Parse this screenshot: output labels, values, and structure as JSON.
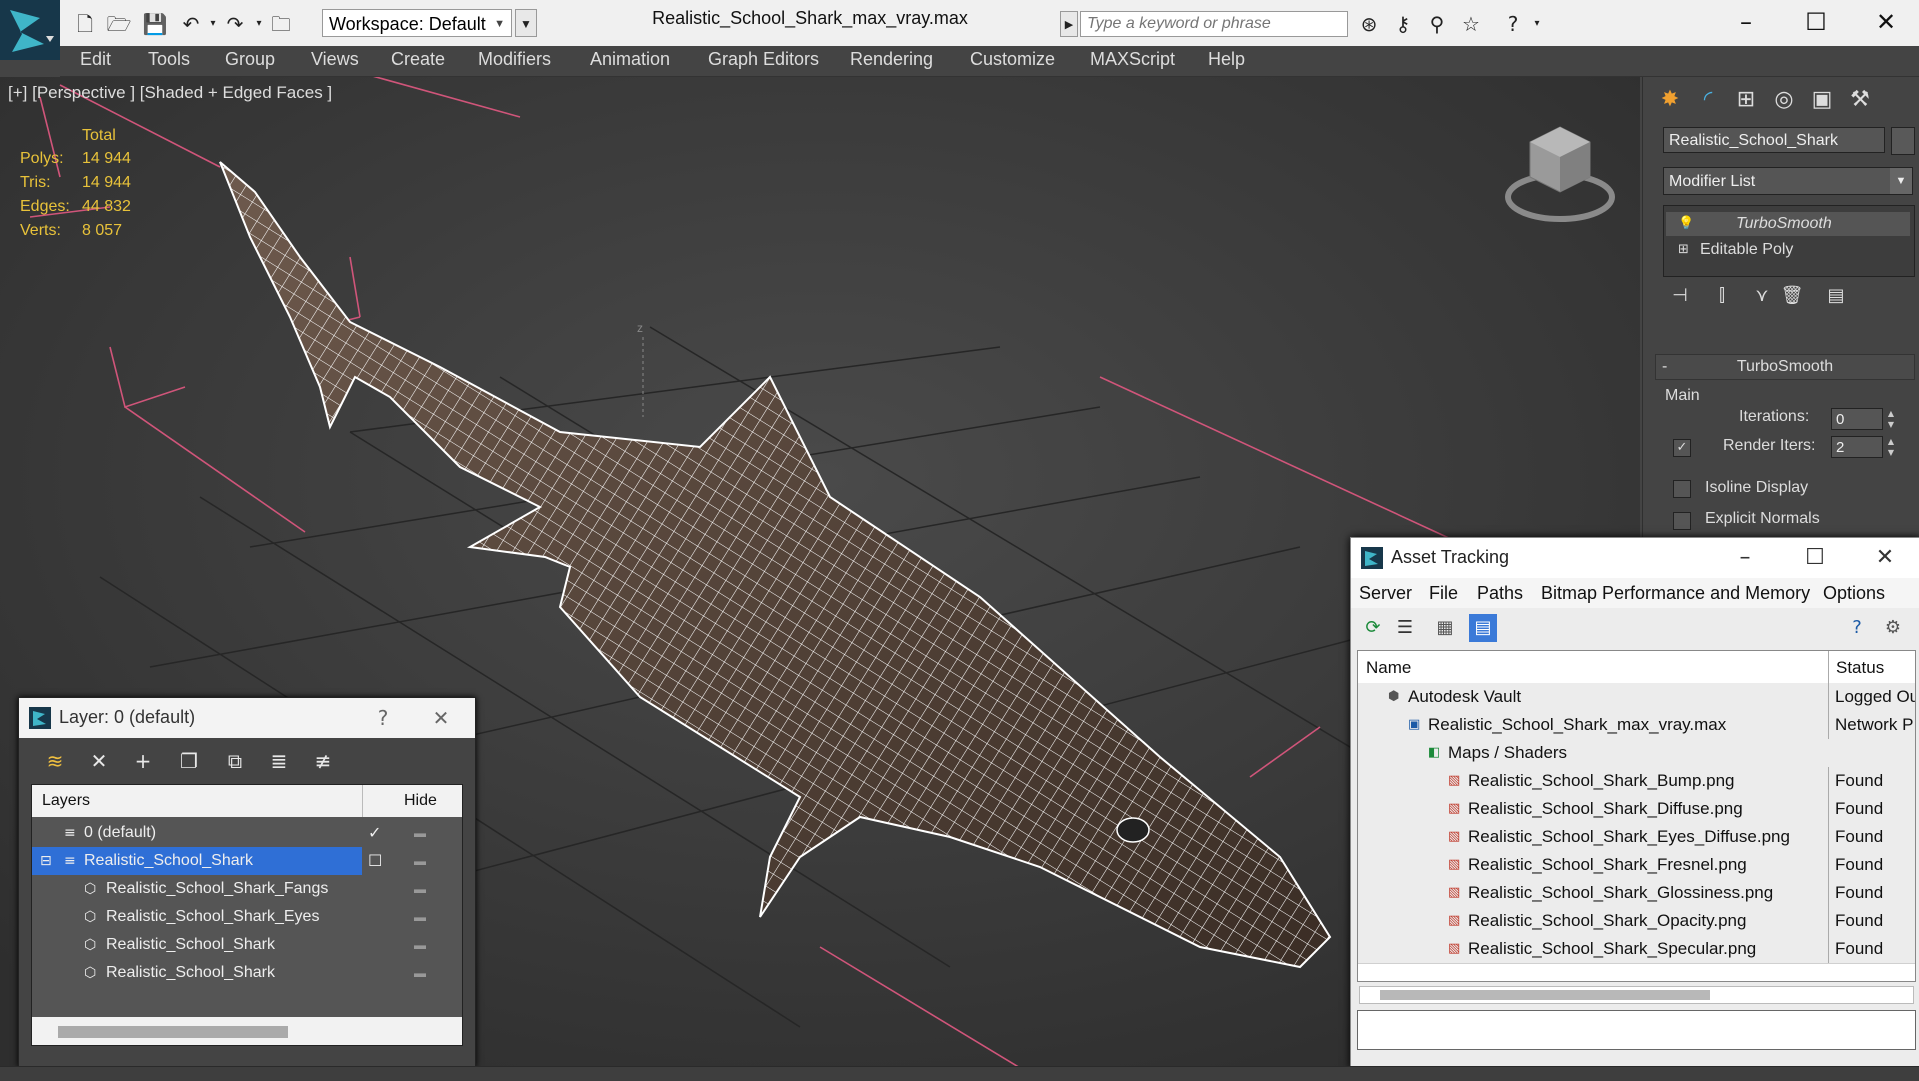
{
  "titlebar": {
    "workspace_label": "Workspace: Default",
    "document_title": "Realistic_School_Shark_max_vray.max",
    "search_placeholder": "Type a keyword or phrase"
  },
  "menubar": {
    "items": [
      "Edit",
      "Tools",
      "Group",
      "Views",
      "Create",
      "Modifiers",
      "Animation",
      "Graph Editors",
      "Rendering",
      "Customize",
      "MAXScript",
      "Help"
    ]
  },
  "viewport": {
    "label": "[+] [Perspective ] [Shaded + Edged Faces ]",
    "stats": {
      "total_label": "Total",
      "rows": [
        {
          "label": "Polys:",
          "value": "14 944"
        },
        {
          "label": "Tris:",
          "value": "14 944"
        },
        {
          "label": "Edges:",
          "value": "44 832"
        },
        {
          "label": "Verts:",
          "value": "8 057"
        }
      ]
    }
  },
  "command_panel": {
    "object_name": "Realistic_School_Shark",
    "modifier_list_label": "Modifier List",
    "stack": [
      "TurboSmooth",
      "Editable Poly"
    ],
    "rollout_title": "TurboSmooth",
    "group_label": "Main",
    "iterations_label": "Iterations:",
    "iterations_value": "0",
    "render_iters_label": "Render Iters:",
    "render_iters_value": "2",
    "isoline_label": "Isoline Display",
    "explicit_normals_label": "Explicit Normals"
  },
  "layer_dialog": {
    "title": "Layer: 0 (default)",
    "help": "?",
    "col_layers": "Layers",
    "col_hide": "Hide",
    "rows": [
      {
        "label": "0 (default)",
        "level": 1
      },
      {
        "label": "Realistic_School_Shark",
        "level": 1
      },
      {
        "label": "Realistic_School_Shark_Fangs",
        "level": 2
      },
      {
        "label": "Realistic_School_Shark_Eyes",
        "level": 2
      },
      {
        "label": "Realistic_School_Shark",
        "level": 2
      },
      {
        "label": "Realistic_School_Shark",
        "level": 2
      }
    ]
  },
  "asset_dialog": {
    "title": "Asset Tracking",
    "menu": [
      "Server",
      "File",
      "Paths",
      "Bitmap Performance and Memory",
      "Options"
    ],
    "col_name": "Name",
    "col_status": "Status",
    "rows": [
      {
        "name": "Autodesk Vault",
        "status": "Logged Ou",
        "level": 1,
        "icon": "vault"
      },
      {
        "name": "Realistic_School_Shark_max_vray.max",
        "status": "Network P",
        "level": 2,
        "icon": "max"
      },
      {
        "name": "Maps / Shaders",
        "status": "",
        "level": 3,
        "icon": "maps"
      },
      {
        "name": "Realistic_School_Shark_Bump.png",
        "status": "Found",
        "level": 4,
        "icon": "png"
      },
      {
        "name": "Realistic_School_Shark_Diffuse.png",
        "status": "Found",
        "level": 4,
        "icon": "png"
      },
      {
        "name": "Realistic_School_Shark_Eyes_Diffuse.png",
        "status": "Found",
        "level": 4,
        "icon": "png"
      },
      {
        "name": "Realistic_School_Shark_Fresnel.png",
        "status": "Found",
        "level": 4,
        "icon": "png"
      },
      {
        "name": "Realistic_School_Shark_Glossiness.png",
        "status": "Found",
        "level": 4,
        "icon": "png"
      },
      {
        "name": "Realistic_School_Shark_Opacity.png",
        "status": "Found",
        "level": 4,
        "icon": "png"
      },
      {
        "name": "Realistic_School_Shark_Specular.png",
        "status": "Found",
        "level": 4,
        "icon": "png"
      }
    ]
  },
  "colors": {
    "stats_yellow": "#e8c23a",
    "selection_blue": "#2f6fd6",
    "grid_red": "#d0557a"
  }
}
